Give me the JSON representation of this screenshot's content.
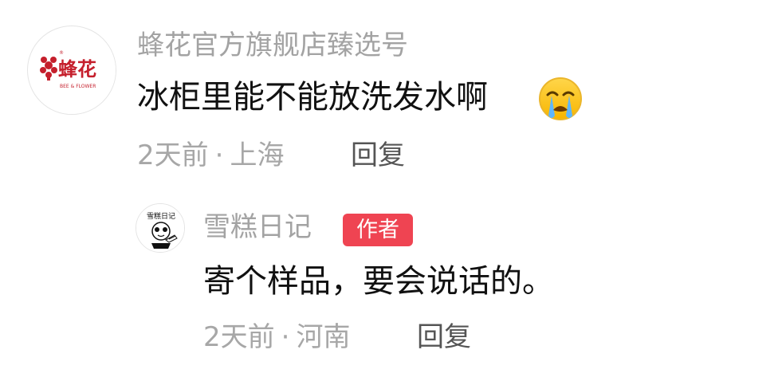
{
  "top_comment": {
    "username": "蜂花官方旗舰店臻选号",
    "avatar_text": "蜂花",
    "avatar_subtext": "BEE & FLOWER",
    "text": "冰柜里能不能放洗发水啊",
    "emoji": "crying-face-icon",
    "meta_time": "2天前",
    "meta_location": "上海",
    "reply_label": "回复"
  },
  "reply_comment": {
    "username": "雪糕日记",
    "avatar_text": "雪糕日记",
    "badge": "作者",
    "text": "寄个样品，要会说话的。",
    "meta_time": "2天前",
    "meta_location": "河南",
    "reply_label": "回复"
  },
  "colors": {
    "username": "#a3a3a3",
    "text": "#111111",
    "meta": "#a7a7a7",
    "reply_link": "#555555",
    "author_badge_bg": "#ef4452",
    "avatar_brand": "#c51f2c"
  }
}
